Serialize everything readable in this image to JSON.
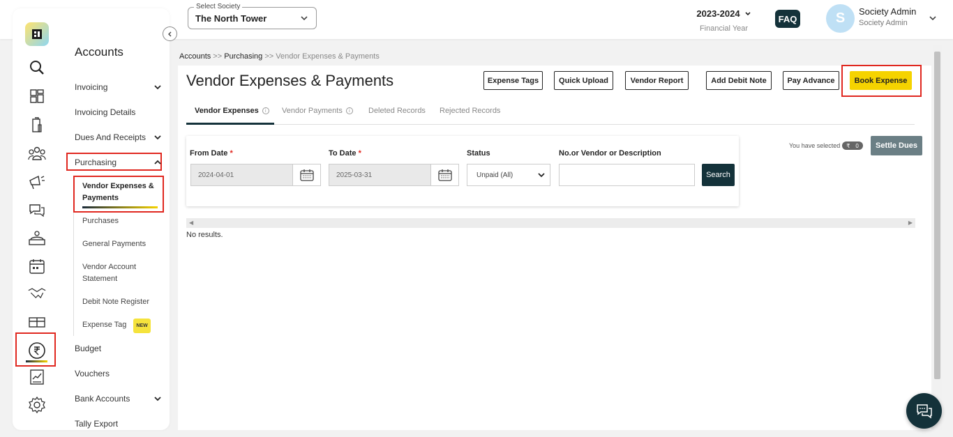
{
  "header": {
    "society_label": "Select Society",
    "society_value": "The North Tower",
    "fy_year": "2023-2024",
    "fy_label": "Financial Year",
    "faq": "FAQ",
    "avatar_initial": "S",
    "user_name": "Society Admin",
    "user_role": "Society Admin"
  },
  "rail": {
    "icons": [
      "search-icon",
      "dashboard-icon",
      "building-icon",
      "members-icon",
      "announcement-icon",
      "chat-icon",
      "helpdesk-icon",
      "calendar-icon",
      "handshake-icon",
      "gift-icon",
      "rupee-icon",
      "report-icon",
      "settings-icon"
    ],
    "active": "rupee-icon"
  },
  "nav": {
    "title": "Accounts",
    "invoicing": "Invoicing",
    "invoicing_details": "Invoicing Details",
    "dues_receipts": "Dues And Receipts",
    "purchasing": "Purchasing",
    "sub": {
      "vendor_expenses": "Vendor Expenses & Payments",
      "purchases": "Purchases",
      "general_payments": "General Payments",
      "vendor_statement": "Vendor Account Statement",
      "debit_register": "Debit Note Register",
      "expense_tag": "Expense Tag",
      "new_badge": "NEW"
    },
    "budget": "Budget",
    "vouchers": "Vouchers",
    "bank_accounts": "Bank Accounts",
    "tally_export": "Tally Export"
  },
  "breadcrumb": {
    "accounts": "Accounts",
    "sep1": " >> ",
    "purchasing": "Purchasing",
    "sep2": " >> ",
    "current": "Vendor Expenses & Payments"
  },
  "page": {
    "title": "Vendor Expenses & Payments",
    "buttons": {
      "expense_tags": "Expense Tags",
      "quick_upload": "Quick Upload",
      "vendor_report": "Vendor Report",
      "add_debit_note": "Add Debit Note",
      "pay_advance": "Pay Advance",
      "book_expense": "Book Expense"
    },
    "tabs": {
      "vendor_expenses": "Vendor Expenses",
      "vendor_payments": "Vendor Payments",
      "deleted": "Deleted Records",
      "rejected": "Rejected Records"
    }
  },
  "filters": {
    "from_label": "From Date",
    "from_value": "2024-04-01",
    "to_label": "To Date",
    "to_value": "2025-03-31",
    "required_mark": "*",
    "status_label": "Status",
    "status_value": "Unpaid (All)",
    "search_label": "No.or Vendor or Description",
    "search_value": "",
    "search_button": "Search"
  },
  "selection": {
    "text": "You have selected",
    "currency": "₹",
    "count": "0",
    "settle_button": "Settle Dues"
  },
  "results": {
    "empty_text": "No results."
  },
  "colors": {
    "accent": "#f5d300",
    "dark": "#14323a",
    "highlight": "#e0271f"
  }
}
